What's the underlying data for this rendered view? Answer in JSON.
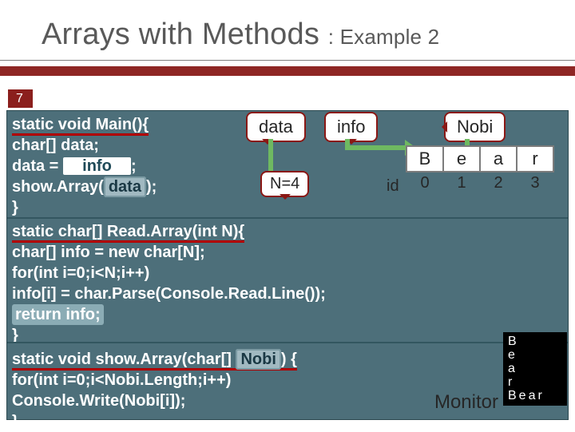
{
  "slide_number": "7",
  "title_main": "Arrays with Methods",
  "title_sub": ": Example 2",
  "code": {
    "main_sig": "static void Main(){",
    "decl": " char[] data;",
    "assign_prefix": " data = ",
    "assign_mid": "info",
    "assign_suffix": ";",
    "show_call": " show.Array(",
    "show_arg": "data",
    "show_tail": ");",
    "main_close": "}",
    "read_sig": "static char[] Read.Array(int N){",
    "read_decl": " char[] info = new char[N];",
    "read_for": " for(int i=0;i<N;i++)",
    "read_body": "   info[i] = char.Parse(Console.Read.Line());",
    "read_return": " return info;",
    "read_close": "}",
    "show_sig_a": "static void show.Array(char[] ",
    "show_sig_param": "Nobi",
    "show_sig_b": ") {",
    "show_for": " for(int i=0;i<Nobi.Length;i++)",
    "show_body": "   Console.Write(Nobi[i]);",
    "close2": "}"
  },
  "labels": {
    "data": "data",
    "info": "info",
    "nobi": "Nobi",
    "n4": "N=4",
    "id": "id",
    "monitor": "Monitor"
  },
  "array": {
    "cells": [
      "B",
      "e",
      "a",
      "r"
    ],
    "indices": [
      "0",
      "1",
      "2",
      "3"
    ]
  },
  "console": {
    "lines": [
      "B",
      "e",
      "a",
      "r",
      "Bear"
    ]
  }
}
